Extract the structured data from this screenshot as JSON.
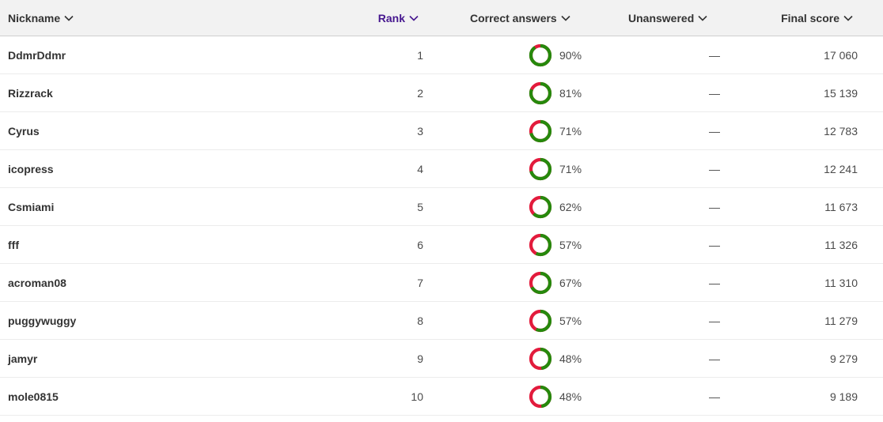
{
  "colors": {
    "correct": "#26890c",
    "incorrect": "#e21b3c",
    "active_sort": "#46178f"
  },
  "header": {
    "nickname": "Nickname",
    "rank": "Rank",
    "correct_answers": "Correct answers",
    "unanswered": "Unanswered",
    "final_score": "Final score"
  },
  "rows": [
    {
      "nickname": "DdmrDdmr",
      "rank": "1",
      "correct_pct": 90,
      "correct_label": "90%",
      "unanswered": "—",
      "score": "17 060"
    },
    {
      "nickname": "Rizzrack",
      "rank": "2",
      "correct_pct": 81,
      "correct_label": "81%",
      "unanswered": "—",
      "score": "15 139"
    },
    {
      "nickname": "Cyrus",
      "rank": "3",
      "correct_pct": 71,
      "correct_label": "71%",
      "unanswered": "—",
      "score": "12 783"
    },
    {
      "nickname": "icopress",
      "rank": "4",
      "correct_pct": 71,
      "correct_label": "71%",
      "unanswered": "—",
      "score": "12 241"
    },
    {
      "nickname": "Csmiami",
      "rank": "5",
      "correct_pct": 62,
      "correct_label": "62%",
      "unanswered": "—",
      "score": "11 673"
    },
    {
      "nickname": "fff",
      "rank": "6",
      "correct_pct": 57,
      "correct_label": "57%",
      "unanswered": "—",
      "score": "11 326"
    },
    {
      "nickname": "acroman08",
      "rank": "7",
      "correct_pct": 67,
      "correct_label": "67%",
      "unanswered": "—",
      "score": "11 310"
    },
    {
      "nickname": "puggywuggy",
      "rank": "8",
      "correct_pct": 57,
      "correct_label": "57%",
      "unanswered": "—",
      "score": "11 279"
    },
    {
      "nickname": "jamyr",
      "rank": "9",
      "correct_pct": 48,
      "correct_label": "48%",
      "unanswered": "—",
      "score": "9 279"
    },
    {
      "nickname": "mole0815",
      "rank": "10",
      "correct_pct": 48,
      "correct_label": "48%",
      "unanswered": "—",
      "score": "9 189"
    }
  ]
}
